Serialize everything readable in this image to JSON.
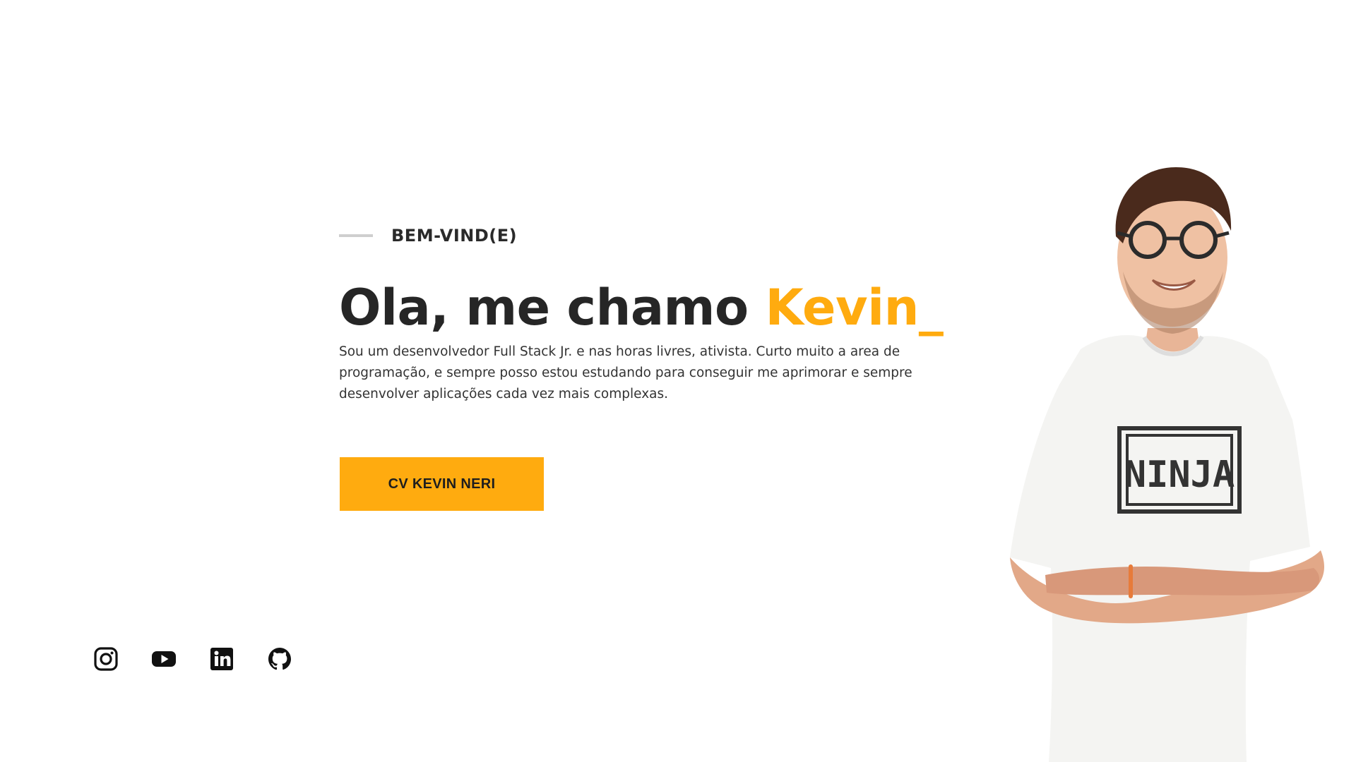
{
  "hero": {
    "eyebrow": "BEM-VIND(E)",
    "headline_prefix": "Ola, me chamo ",
    "headline_name": "Kevin_",
    "bio": "Sou um desenvolvedor Full Stack Jr. e nas horas livres, ativista. Curto muito a area de programação, e sempre posso estou estudando para conseguir me aprimorar e sempre desenvolver aplicações cada vez mais complexas.",
    "cv_button": "CV KEVIN NERI",
    "shirt_print": "NINJA"
  },
  "socials": [
    {
      "icon": "instagram-icon"
    },
    {
      "icon": "youtube-icon"
    },
    {
      "icon": "linkedin-icon"
    },
    {
      "icon": "github-icon"
    }
  ],
  "colors": {
    "accent": "#ffab0f",
    "text": "#262626",
    "background": "#ffffff"
  }
}
